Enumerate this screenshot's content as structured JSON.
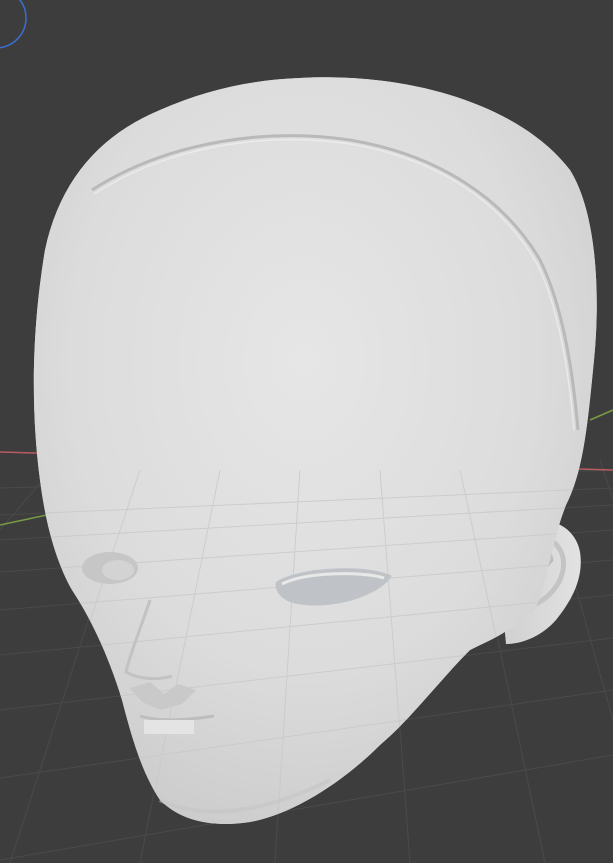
{
  "viewport": {
    "background_color": "#3d3d3d",
    "grid_color": "#4a4a4a",
    "x_axis_color": "#b85c62",
    "y_axis_color": "#7a9a43",
    "gizmo_color": "#3a6fd3",
    "model": {
      "name": "",
      "shading": "solid",
      "base_color": "#dcdcdc"
    },
    "navigation_gizmo_icon": "view-orbit-circle-icon"
  }
}
